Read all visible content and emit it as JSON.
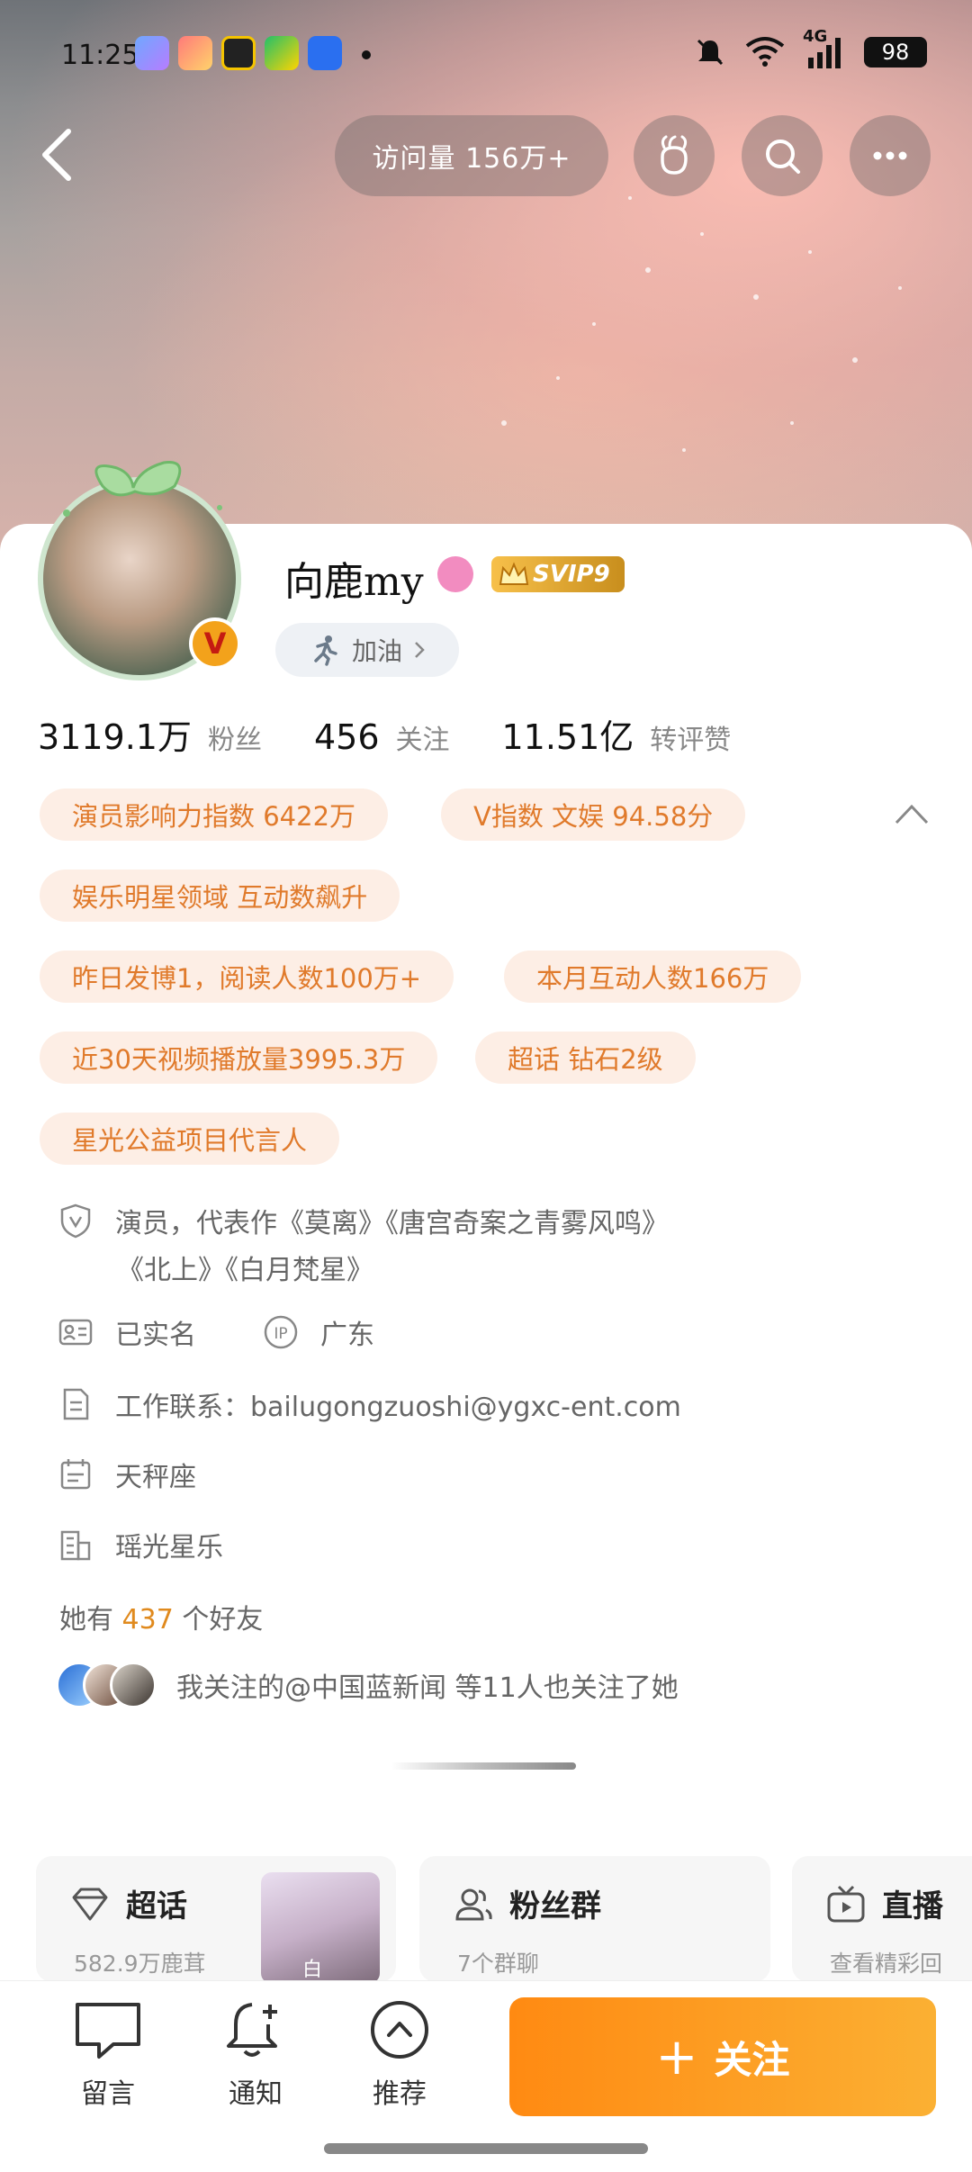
{
  "status_bar": {
    "time": "11:25",
    "network": "4G",
    "battery": "98"
  },
  "header": {
    "visits_label": "访问量 156万+"
  },
  "profile": {
    "name": "向鹿my",
    "vip_badge": "SVIP9",
    "cheer_label": "加油",
    "verified_mark": "V",
    "stats": [
      {
        "value": "3119.1万",
        "label": "粉丝"
      },
      {
        "value": "456",
        "label": "关注"
      },
      {
        "value": "11.51亿",
        "label": "转评赞"
      }
    ]
  },
  "chips": [
    "演员影响力指数 6422万",
    "V指数 文娱 94.58分",
    "娱乐明星领域 互动数飙升",
    "昨日发博1，阅读人数100万+",
    "本月互动人数166万",
    "近30天视频播放量3995.3万",
    "超话 钻石2级",
    "星光公益项目代言人"
  ],
  "info": {
    "bio_line1": "演员，代表作《莫离》《唐宫奇案之青雾风鸣》",
    "bio_line2": "《北上》《白月梵星》",
    "realname": "已实名",
    "ip_label": "广东",
    "contact": "工作联系：bailugongzuoshi@ygxc-ent.com",
    "zodiac": "天秤座",
    "company": "瑶光星乐",
    "friends_prefix": "她有",
    "friends_count": "437",
    "friends_suffix": "个好友",
    "mutual_text": "我关注的@中国蓝新闻 等11人也关注了她"
  },
  "features": [
    {
      "title": "超话",
      "subtitle": "582.9万鹿茸",
      "thumb_caption": "白"
    },
    {
      "title": "粉丝群",
      "subtitle": "7个群聊"
    },
    {
      "title": "直播",
      "subtitle": "查看精彩回"
    }
  ],
  "bottom_bar": {
    "message": "留言",
    "notify": "通知",
    "recommend": "推荐",
    "follow": "关注",
    "follow_plus": "+"
  },
  "colors": {
    "accent_orange": "#ff8a12",
    "chip_bg": "#fdeee5",
    "chip_text": "#e07a2b"
  }
}
